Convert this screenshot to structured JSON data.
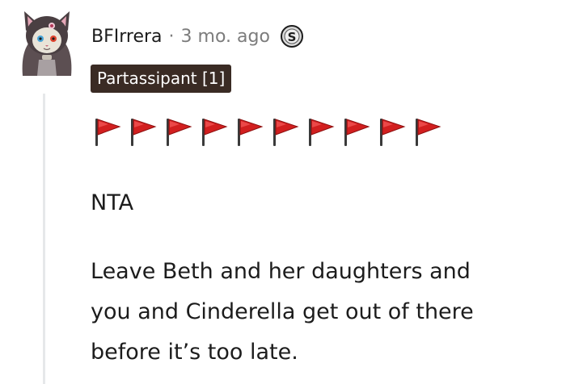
{
  "comment": {
    "author": "BFIrrera",
    "separator": "·",
    "timestamp": "3 mo. ago",
    "award_icon": "silver-coin-icon",
    "flair": "Partassipant [1]",
    "flags": {
      "icon": "red-flag-icon",
      "count": 10,
      "color": "#d21f1f"
    },
    "verdict": "NTA",
    "paragraph_lines": [
      "Leave Beth and her daughters and",
      "you and Cinderella get out of there",
      "before it’s too late."
    ]
  },
  "colors": {
    "text": "#1c1c1c",
    "meta": "#7c7c7c",
    "flair_bg": "#3a2b24",
    "thread_line": "#e6e8ea"
  }
}
